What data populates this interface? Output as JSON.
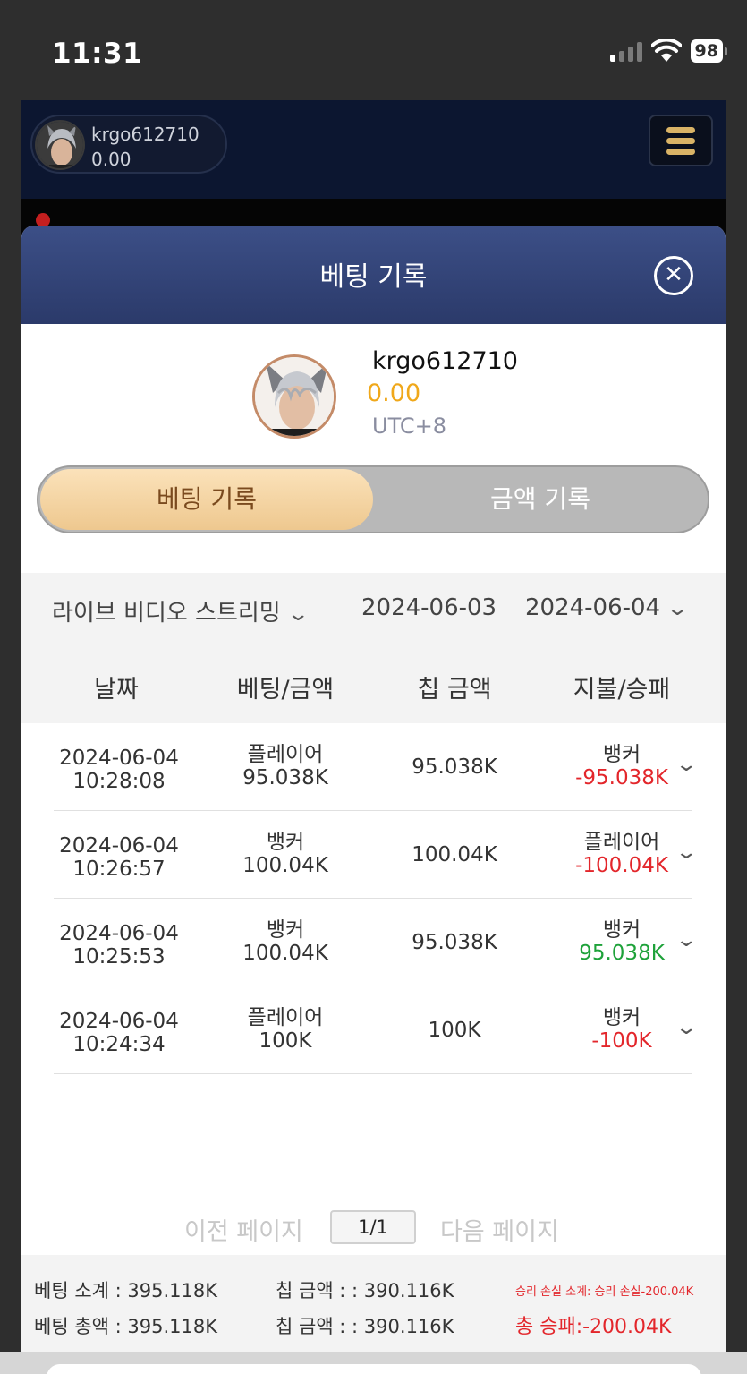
{
  "status_bar": {
    "time": "11:31",
    "battery": "98"
  },
  "game_header": {
    "username": "krgo612710",
    "balance": "0.00"
  },
  "modal": {
    "title": "베팅 기록",
    "profile": {
      "username": "krgo612710",
      "balance": "0.00",
      "timezone": "UTC+8"
    },
    "tabs": [
      {
        "label": "베팅 기록",
        "active": true
      },
      {
        "label": "금액 기록",
        "active": false
      }
    ],
    "filters": {
      "game_type": "라이브 비디오 스트리밍",
      "start_date": "2024-06-03",
      "end_date": "2024-06-04"
    },
    "columns": [
      "날짜",
      "베팅/금액",
      "칩 금액",
      "지불/승패"
    ],
    "rows": [
      {
        "date": "2024-06-04",
        "time": "10:28:08",
        "bet_on": "플레이어",
        "bet_amount": "95.038K",
        "chip_amount": "95.038K",
        "result": "뱅커",
        "win_loss": "-95.038K",
        "win_loss_color": "#e3262b"
      },
      {
        "date": "2024-06-04",
        "time": "10:26:57",
        "bet_on": "뱅커",
        "bet_amount": "100.04K",
        "chip_amount": "100.04K",
        "result": "플레이어",
        "win_loss": "-100.04K",
        "win_loss_color": "#e3262b"
      },
      {
        "date": "2024-06-04",
        "time": "10:25:53",
        "bet_on": "뱅커",
        "bet_amount": "100.04K",
        "chip_amount": "95.038K",
        "result": "뱅커",
        "win_loss": "95.038K",
        "win_loss_color": "#1ea23a"
      },
      {
        "date": "2024-06-04",
        "time": "10:24:34",
        "bet_on": "플레이어",
        "bet_amount": "100K",
        "chip_amount": "100K",
        "result": "뱅커",
        "win_loss": "-100K",
        "win_loss_color": "#e3262b"
      }
    ],
    "pagination": {
      "prev_label": "이전 페이지",
      "page": "1/1",
      "next_label": "다음 페이지"
    },
    "summary": {
      "bet_subtotal": "베팅 소계 : 395.118K",
      "chip_subtotal": "칩 금액 : : 390.116K",
      "winloss_subtotal": "승리 손실 소계: 승리 손실-200.04K",
      "bet_total": "베팅 총액 : 395.118K",
      "chip_total": "칩 금액 : : 390.116K",
      "winloss_total": "총 승패:-200.04K"
    }
  }
}
